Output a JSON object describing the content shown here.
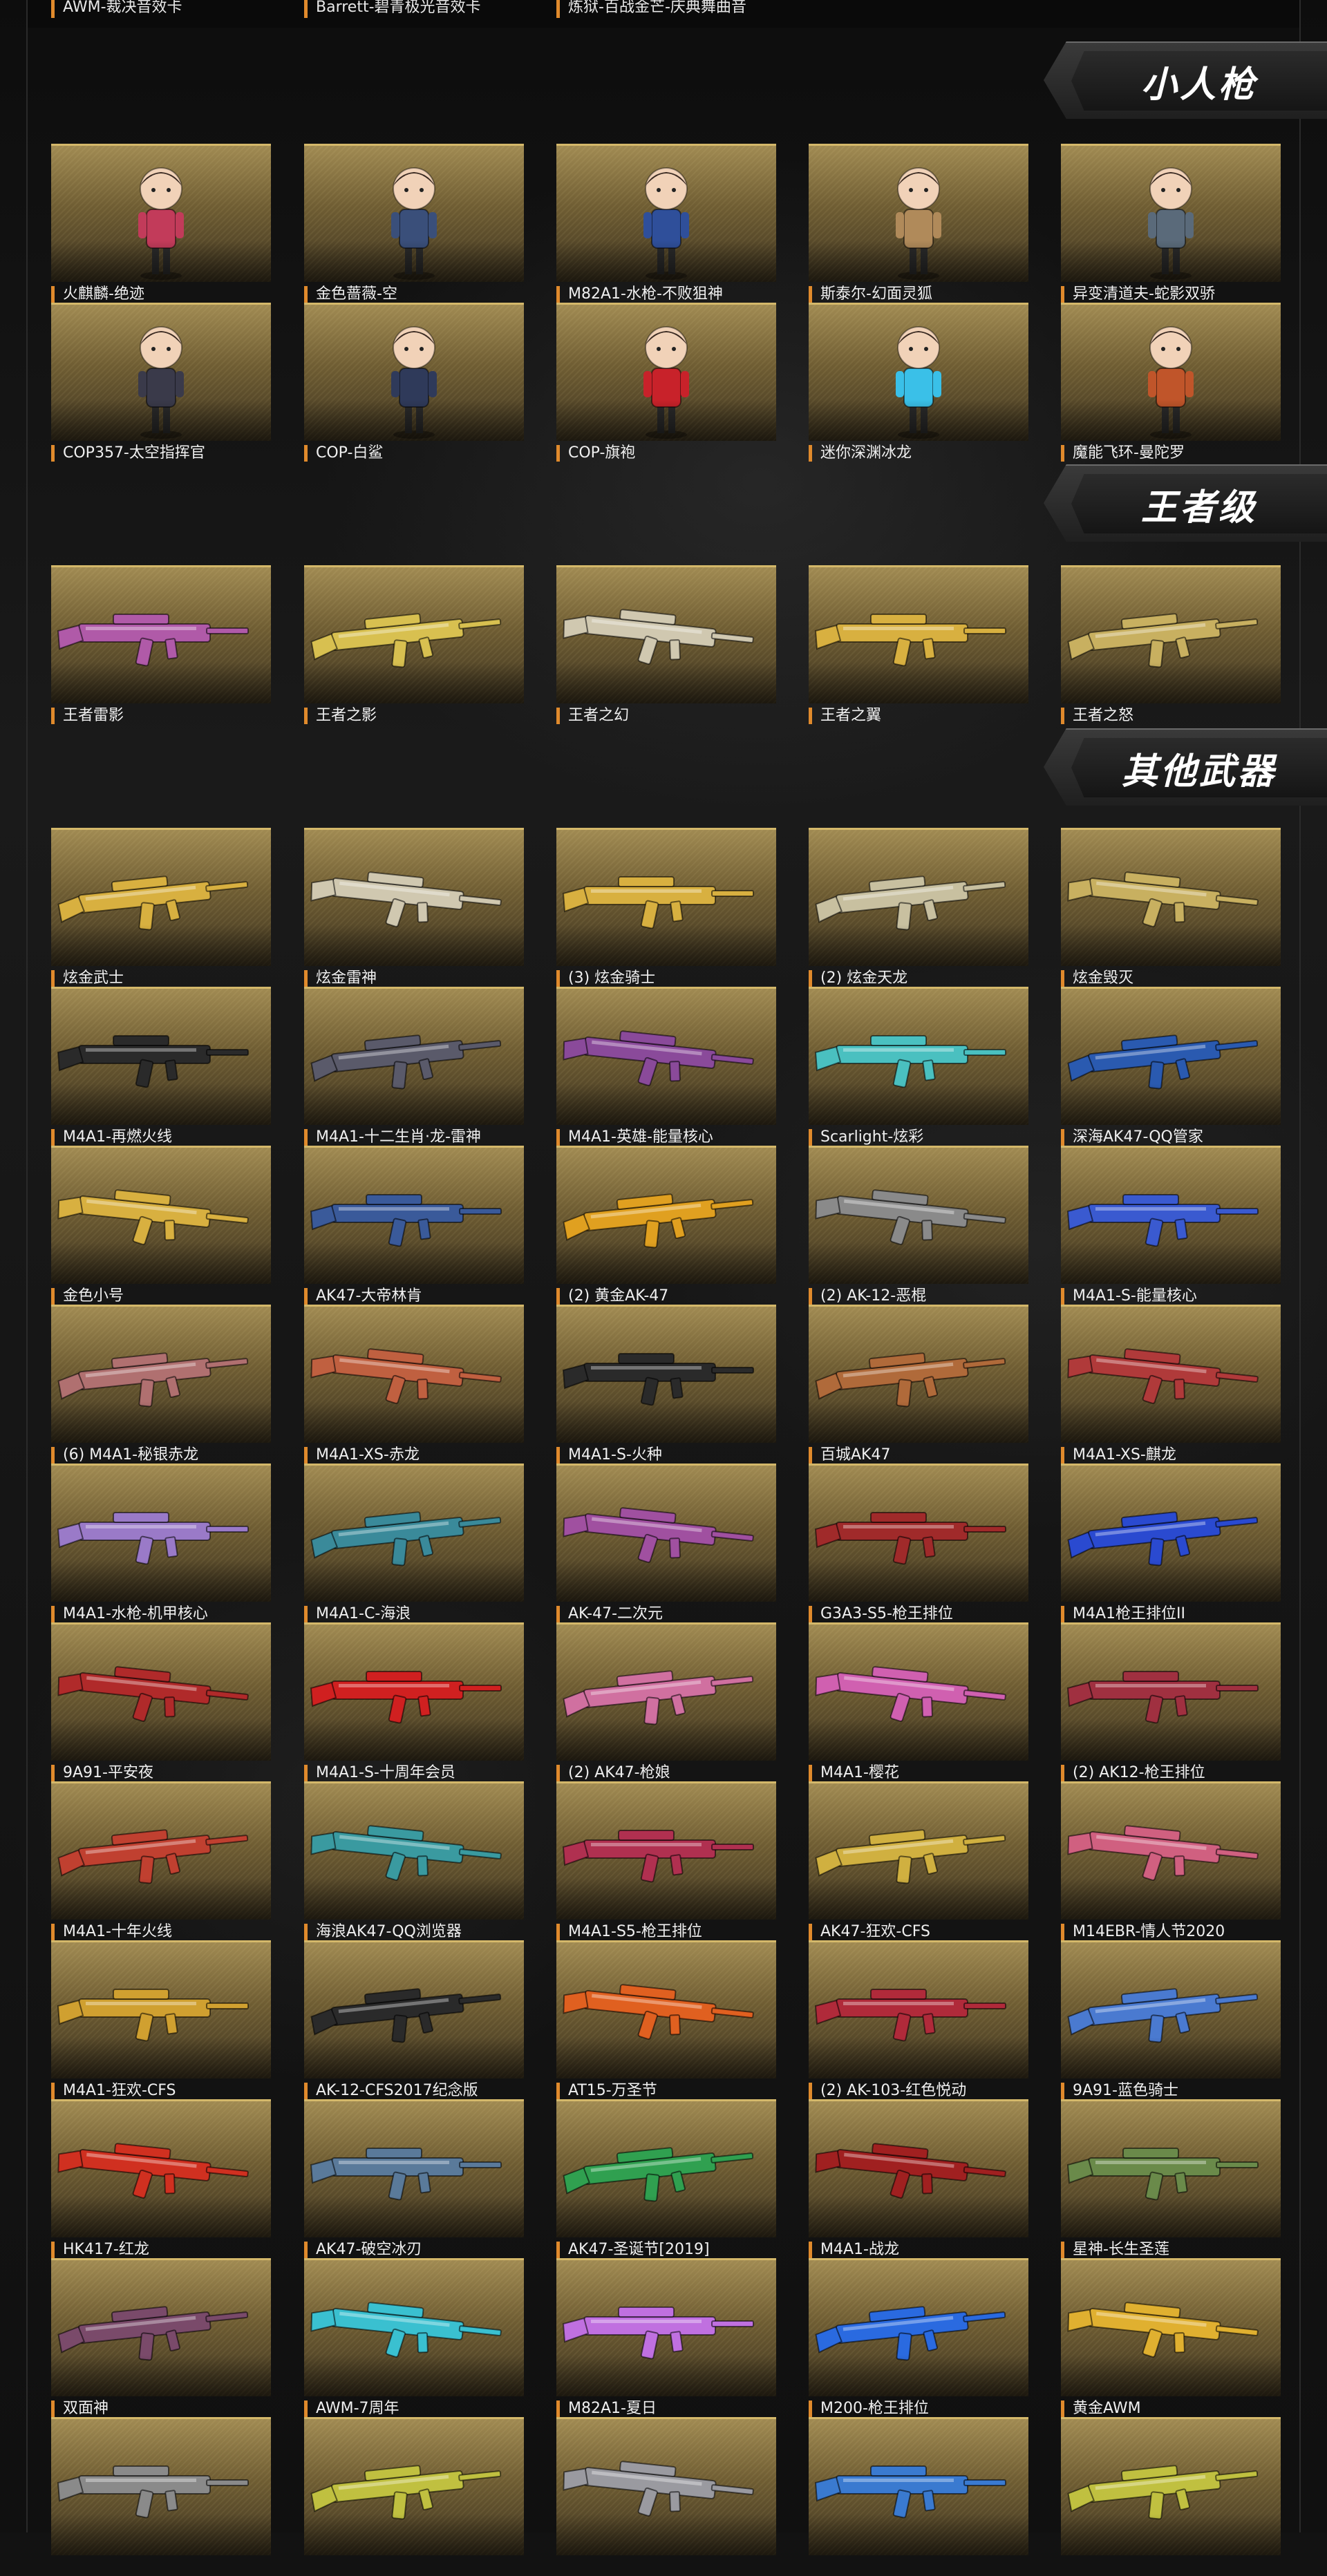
{
  "top_row": [
    "AWM-裁决音效卡",
    "Barrett-碧青极光音效卡",
    "炼狱-百战金芒-庆典舞曲音"
  ],
  "sections": [
    {
      "title": "小人枪",
      "items": [
        {
          "label": "火麒麟-绝迹",
          "kind": "figure",
          "color": "#c23b5a"
        },
        {
          "label": "金色蔷薇-空",
          "kind": "figure",
          "color": "#3a4f7a"
        },
        {
          "label": "M82A1-水枪-不败狙神",
          "kind": "figure",
          "color": "#2f4f9a"
        },
        {
          "label": "斯泰尔-幻面灵狐",
          "kind": "figure",
          "color": "#b08a5a"
        },
        {
          "label": "异变清道夫-蛇影双骄",
          "kind": "figure",
          "color": "#5a6a7a"
        },
        {
          "label": "COP357-太空指挥官",
          "kind": "figure",
          "color": "#3a3a4a"
        },
        {
          "label": "COP-白鲨",
          "kind": "figure",
          "color": "#2f3a5a"
        },
        {
          "label": "COP-旗袍",
          "kind": "figure",
          "color": "#c8222a"
        },
        {
          "label": "迷你深渊冰龙",
          "kind": "figure",
          "color": "#3ac0e8"
        },
        {
          "label": "魔能飞环-曼陀罗",
          "kind": "figure",
          "color": "#c0552a"
        }
      ]
    },
    {
      "title": "王者级",
      "items": [
        {
          "label": "王者雷影",
          "kind": "gun",
          "color": "#b05aa8"
        },
        {
          "label": "王者之影",
          "kind": "gun",
          "color": "#d8c050"
        },
        {
          "label": "王者之幻",
          "kind": "gun",
          "color": "#d0c8b0"
        },
        {
          "label": "王者之翼",
          "kind": "gun",
          "color": "#d8b040"
        },
        {
          "label": "王者之怒",
          "kind": "gun",
          "color": "#c8b060"
        }
      ]
    },
    {
      "title": "其他武器",
      "items": [
        {
          "label": "炫金武士",
          "kind": "gun",
          "color": "#d8b040"
        },
        {
          "label": "炫金雷神",
          "kind": "gun",
          "color": "#d0c8b0"
        },
        {
          "label": "(3) 炫金骑士",
          "kind": "gun",
          "color": "#d8b040"
        },
        {
          "label": "(2) 炫金天龙",
          "kind": "gun",
          "color": "#c8c0a0"
        },
        {
          "label": "炫金毁灭",
          "kind": "gun",
          "color": "#c8b060"
        },
        {
          "label": "M4A1-再燃火线",
          "kind": "gun",
          "color": "#2a2a2a"
        },
        {
          "label": "M4A1-十二生肖·龙-雷神",
          "kind": "gun",
          "color": "#5a5a6a"
        },
        {
          "label": "M4A1-英雄-能量核心",
          "kind": "gun",
          "color": "#8a4a9a"
        },
        {
          "label": "Scarlight-炫彩",
          "kind": "gun",
          "color": "#4ac0c0"
        },
        {
          "label": "深海AK47-QQ管家",
          "kind": "gun",
          "color": "#2a5ab0"
        },
        {
          "label": "金色小号",
          "kind": "gun",
          "color": "#d8b040"
        },
        {
          "label": "AK47-大帝林肯",
          "kind": "gun",
          "color": "#3a5a9a"
        },
        {
          "label": "(2) 黄金AK-47",
          "kind": "gun",
          "color": "#e0a020"
        },
        {
          "label": "(2) AK-12-恶棍",
          "kind": "gun",
          "color": "#8a8a8a"
        },
        {
          "label": "M4A1-S-能量核心",
          "kind": "gun",
          "color": "#3a5ad0"
        },
        {
          "label": "(6) M4A1-秘银赤龙",
          "kind": "gun",
          "color": "#b07070"
        },
        {
          "label": "M4A1-XS-赤龙",
          "kind": "gun",
          "color": "#c06040"
        },
        {
          "label": "M4A1-S-火种",
          "kind": "gun",
          "color": "#2a2a2a"
        },
        {
          "label": "百城AK47",
          "kind": "gun",
          "color": "#b06a3a"
        },
        {
          "label": "M4A1-XS-麒龙",
          "kind": "gun",
          "color": "#b03a3a"
        },
        {
          "label": "M4A1-水枪-机甲核心",
          "kind": "gun",
          "color": "#9a7ac8"
        },
        {
          "label": "M4A1-C-海浪",
          "kind": "gun",
          "color": "#3a8a9a"
        },
        {
          "label": "AK-47-二次元",
          "kind": "gun",
          "color": "#a050a0"
        },
        {
          "label": "G3A3-S5-枪王排位",
          "kind": "gun",
          "color": "#a02a2a"
        },
        {
          "label": "M4A1枪王排位II",
          "kind": "gun",
          "color": "#2a4ad0"
        },
        {
          "label": "9A91-平安夜",
          "kind": "gun",
          "color": "#b02a2a"
        },
        {
          "label": "M4A1-S-十周年会员",
          "kind": "gun",
          "color": "#d02020"
        },
        {
          "label": "(2) AK47-枪娘",
          "kind": "gun",
          "color": "#d070a0"
        },
        {
          "label": "M4A1-樱花",
          "kind": "gun",
          "color": "#d060b0"
        },
        {
          "label": "(2) AK12-枪王排位",
          "kind": "gun",
          "color": "#a03040"
        },
        {
          "label": "M4A1-十年火线",
          "kind": "gun",
          "color": "#c04030"
        },
        {
          "label": "海浪AK47-QQ浏览器",
          "kind": "gun",
          "color": "#3a9aa0"
        },
        {
          "label": "M4A1-S5-枪王排位",
          "kind": "gun",
          "color": "#b03050"
        },
        {
          "label": "AK47-狂欢-CFS",
          "kind": "gun",
          "color": "#d0b040"
        },
        {
          "label": "M14EBR-情人节2020",
          "kind": "gun",
          "color": "#d06080"
        },
        {
          "label": "M4A1-狂欢-CFS",
          "kind": "gun",
          "color": "#d0a030"
        },
        {
          "label": "AK-12-CFS2017纪念版",
          "kind": "gun",
          "color": "#2a2a2a"
        },
        {
          "label": "AT15-万圣节",
          "kind": "gun",
          "color": "#e06020"
        },
        {
          "label": "(2) AK-103-红色悦动",
          "kind": "gun",
          "color": "#b02a3a"
        },
        {
          "label": "9A91-蓝色骑士",
          "kind": "gun",
          "color": "#4a7ad0"
        },
        {
          "label": "HK417-红龙",
          "kind": "gun",
          "color": "#d03020"
        },
        {
          "label": "AK47-破空冰刃",
          "kind": "gun",
          "color": "#5a7a9a"
        },
        {
          "label": "AK47-圣诞节[2019]",
          "kind": "gun",
          "color": "#30a050"
        },
        {
          "label": "M4A1-战龙",
          "kind": "gun",
          "color": "#a02020"
        },
        {
          "label": "星神-长生圣莲",
          "kind": "gun",
          "color": "#6a8a4a"
        },
        {
          "label": "双面神",
          "kind": "gun",
          "color": "#7a4a6a"
        },
        {
          "label": "AWM-7周年",
          "kind": "gun",
          "color": "#3ac0d0"
        },
        {
          "label": "M82A1-夏日",
          "kind": "gun",
          "color": "#c070e0"
        },
        {
          "label": "M200-枪王排位",
          "kind": "gun",
          "color": "#2a6ae0"
        },
        {
          "label": "黄金AWM",
          "kind": "gun",
          "color": "#e0b030"
        },
        {
          "label": "",
          "kind": "gun",
          "color": "#8a8a8a"
        },
        {
          "label": "",
          "kind": "gun",
          "color": "#c0c040"
        },
        {
          "label": "",
          "kind": "gun",
          "color": "#9a9aa0"
        },
        {
          "label": "",
          "kind": "gun",
          "color": "#3a7ad0"
        },
        {
          "label": "",
          "kind": "gun",
          "color": "#c0c040"
        }
      ]
    }
  ]
}
